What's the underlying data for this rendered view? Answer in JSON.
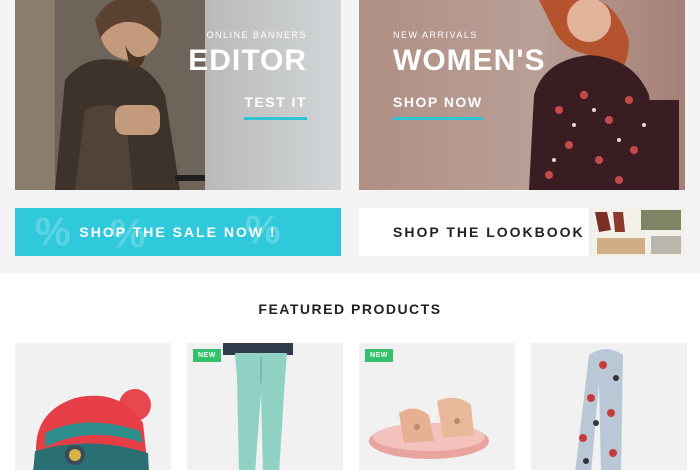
{
  "banners": {
    "left": {
      "kicker": "ONLINE BANNERS",
      "headline": "EDITOR",
      "cta": "TEST IT"
    },
    "right": {
      "kicker": "NEW ARRIVALS",
      "headline": "WOMEN'S",
      "cta": "SHOP NOW"
    }
  },
  "strips": {
    "sale": {
      "label": "SHOP THE SALE NOW !",
      "bg_text": "%"
    },
    "lookbook": {
      "label": "SHOP THE LOOKBOOK"
    }
  },
  "featured": {
    "title": "FEATURED PRODUCTS",
    "products": [
      {
        "name": "knit-beanie",
        "badge": ""
      },
      {
        "name": "mint-jeans",
        "badge": "NEW"
      },
      {
        "name": "rose-gold-sandals",
        "badge": "NEW"
      },
      {
        "name": "printed-scarf",
        "badge": ""
      }
    ]
  },
  "colors": {
    "accent": "#2fc9db",
    "new_badge": "#33c26b"
  }
}
